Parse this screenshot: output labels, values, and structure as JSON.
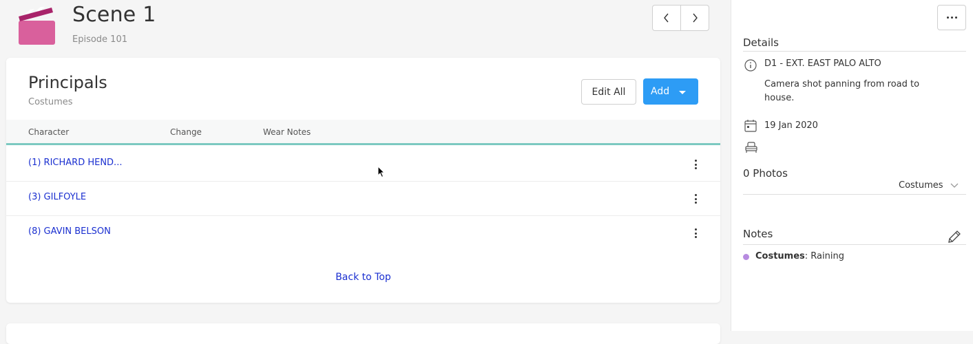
{
  "header": {
    "scene_title": "Scene 1",
    "episode": "Episode 101",
    "clapper_color": "#d9609c"
  },
  "card": {
    "title": "Principals",
    "subtitle": "Costumes",
    "edit_all_label": "Edit All",
    "add_label": "Add",
    "add_color": "#2d9cf5",
    "columns": [
      "Character",
      "Change",
      "Wear Notes"
    ],
    "rows": [
      {
        "name": "(1) RICHARD HEND..."
      },
      {
        "name": "(3) GILFOYLE"
      },
      {
        "name": "(8) GAVIN BELSON"
      }
    ],
    "back_to_top": "Back to Top"
  },
  "sidebar": {
    "details_title": "Details",
    "location": "D1 - EXT. EAST PALO ALTO",
    "description": "Camera shot panning from road to house.",
    "date": "19 Jan 2020",
    "photos_label": "0 Photos",
    "photos_filter": "Costumes",
    "notes_title": "Notes",
    "note_category": "Costumes",
    "note_text": ": Raining",
    "note_dot_color": "#b78be0"
  }
}
